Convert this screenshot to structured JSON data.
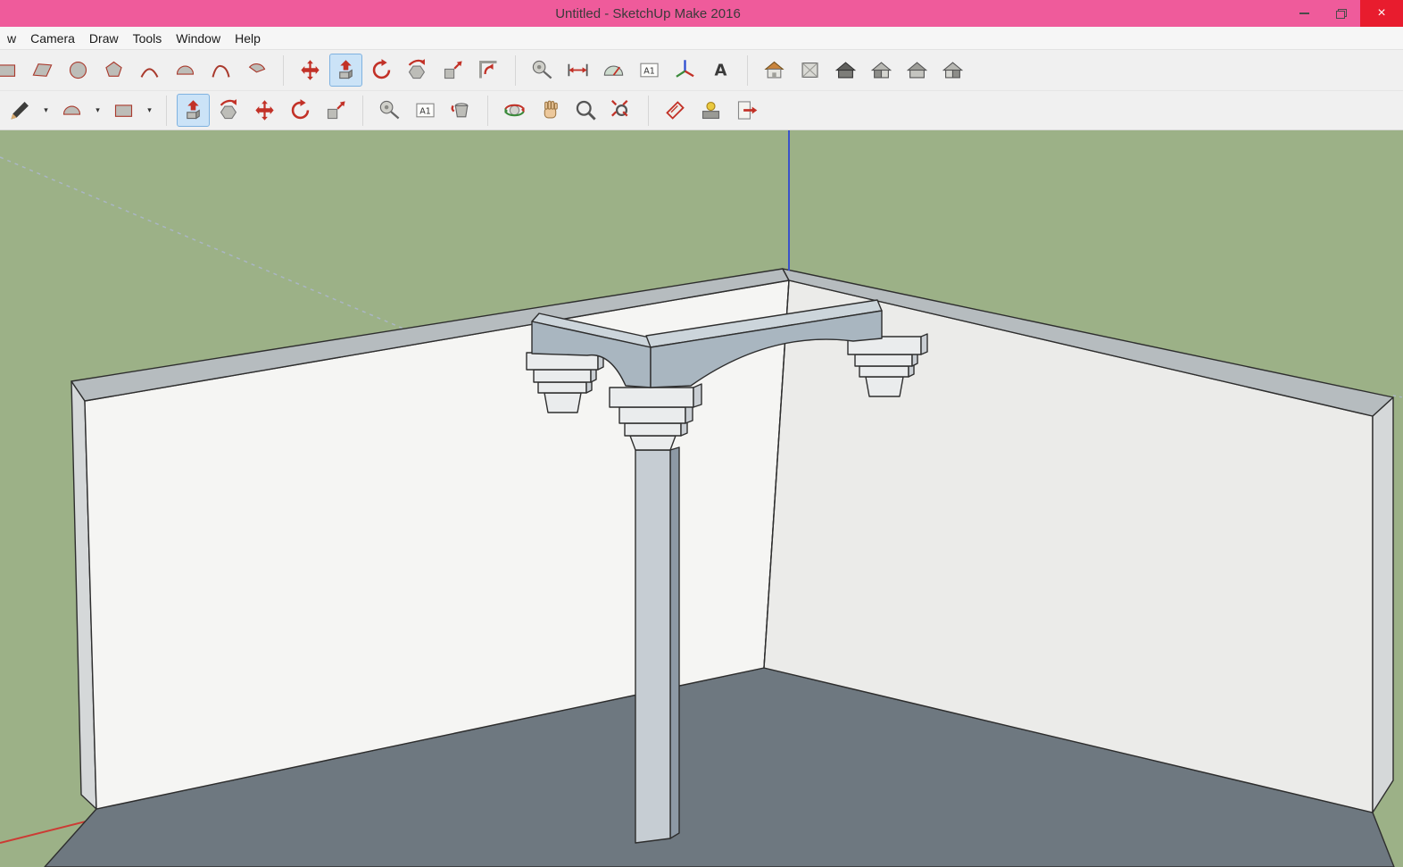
{
  "window": {
    "title": "Untitled - SketchUp Make 2016",
    "titlebar_color": "#ef5b9b",
    "close_color": "#e81c2e",
    "controls": {
      "close_glyph": "×"
    }
  },
  "menu": {
    "items": [
      {
        "name": "menu-view-partial",
        "label": "w"
      },
      {
        "name": "menu-camera",
        "label": "Camera"
      },
      {
        "name": "menu-draw",
        "label": "Draw"
      },
      {
        "name": "menu-tools",
        "label": "Tools"
      },
      {
        "name": "menu-window",
        "label": "Window"
      },
      {
        "name": "menu-help",
        "label": "Help"
      }
    ]
  },
  "toolbars": {
    "row1": [
      {
        "name": "rectangle-tool",
        "icon": "#i-rect",
        "cut": true
      },
      {
        "name": "rotated-rectangle-tool",
        "icon": "#i-rect-rot"
      },
      {
        "name": "circle-tool",
        "icon": "#i-circle"
      },
      {
        "name": "polygon-tool",
        "icon": "#i-polygon"
      },
      {
        "name": "arc-tool",
        "icon": "#i-arc"
      },
      {
        "name": "two-point-arc-tool",
        "icon": "#i-arc2"
      },
      {
        "name": "three-point-arc-tool",
        "icon": "#i-arc3"
      },
      {
        "name": "pie-tool",
        "icon": "#i-pie"
      },
      {
        "type": "sep"
      },
      {
        "name": "move-tool",
        "icon": "#i-move"
      },
      {
        "name": "push-pull-tool",
        "icon": "#i-pushpull",
        "active": true
      },
      {
        "name": "rotate-tool",
        "icon": "#i-rotate"
      },
      {
        "name": "follow-me-tool",
        "icon": "#i-followme"
      },
      {
        "name": "scale-tool",
        "icon": "#i-scale"
      },
      {
        "name": "offset-tool",
        "icon": "#i-offset"
      },
      {
        "type": "sep"
      },
      {
        "name": "tape-measure-tool",
        "icon": "#i-tape"
      },
      {
        "name": "dimension-tool",
        "icon": "#i-dim"
      },
      {
        "name": "protractor-tool",
        "icon": "#i-protractor"
      },
      {
        "name": "text-tool",
        "icon": "#i-text"
      },
      {
        "name": "axes-tool",
        "icon": "#i-axes"
      },
      {
        "name": "3d-text-tool",
        "icon": "#i-3dtext"
      },
      {
        "type": "sep"
      },
      {
        "name": "iso-view",
        "icon": "#i-house-iso"
      },
      {
        "name": "top-view",
        "icon": "#i-house-top"
      },
      {
        "name": "front-view",
        "icon": "#i-house-front"
      },
      {
        "name": "right-view",
        "icon": "#i-house-right"
      },
      {
        "name": "back-view",
        "icon": "#i-house-back"
      },
      {
        "name": "left-view",
        "icon": "#i-house-left"
      }
    ],
    "row2": [
      {
        "name": "line-tool",
        "icon": "#i-pencil"
      },
      {
        "name": "line-tool-flyout",
        "type": "dd",
        "glyph": "▾"
      },
      {
        "name": "arcs-tool",
        "icon": "#i-arc2"
      },
      {
        "name": "arcs-tool-flyout",
        "type": "dd",
        "glyph": "▾"
      },
      {
        "name": "rectangle-shapes-tool",
        "icon": "#i-rect"
      },
      {
        "name": "rectangle-shapes-tool-flyout",
        "type": "dd",
        "glyph": "▾"
      },
      {
        "type": "sep"
      },
      {
        "name": "push-pull-tool-2",
        "icon": "#i-pushpull",
        "active": true
      },
      {
        "name": "follow-me-tool-2",
        "icon": "#i-followme"
      },
      {
        "name": "move-tool-2",
        "icon": "#i-move"
      },
      {
        "name": "rotate-tool-2",
        "icon": "#i-rotate"
      },
      {
        "name": "scale-tool-2",
        "icon": "#i-scale"
      },
      {
        "type": "sep"
      },
      {
        "name": "tape-measure-tool-2",
        "icon": "#i-tape"
      },
      {
        "name": "text-tool-2",
        "icon": "#i-text"
      },
      {
        "name": "paint-bucket-tool",
        "icon": "#i-paint"
      },
      {
        "type": "sep"
      },
      {
        "name": "orbit-tool",
        "icon": "#i-orbit"
      },
      {
        "name": "pan-tool",
        "icon": "#i-pan"
      },
      {
        "name": "zoom-tool",
        "icon": "#i-zoom"
      },
      {
        "name": "zoom-extents-tool",
        "icon": "#i-zoomext"
      },
      {
        "type": "sep"
      },
      {
        "name": "section-plane-tool",
        "icon": "#i-section"
      },
      {
        "name": "shadows-toggle",
        "icon": "#i-shadows"
      },
      {
        "name": "export-share",
        "icon": "#i-export"
      }
    ]
  },
  "viewport": {
    "scene": "interior corner of two white walls with square column, arched beams and pilaster capitals",
    "active_tool": "push-pull",
    "colors": {
      "sky": "#9cb187",
      "wall_left": "#f5f5f3",
      "wall_right": "#ebebe9",
      "wall_top": "#b6bcbf",
      "wall_edge_cap": "#d5d8d9",
      "floor": "#6e7880",
      "column_front": "#c6cdd3",
      "column_side": "#8d99a5",
      "beam_front": "#a9b6c0",
      "beam_top": "#ccd5db",
      "capital": "#eaeced",
      "capital_side": "#c9ced3",
      "axis_blue": "#3a53c8",
      "axis_red": "#cc3b34",
      "guide_dash": "#aab6c4",
      "edge": "#2e2e2e"
    }
  }
}
